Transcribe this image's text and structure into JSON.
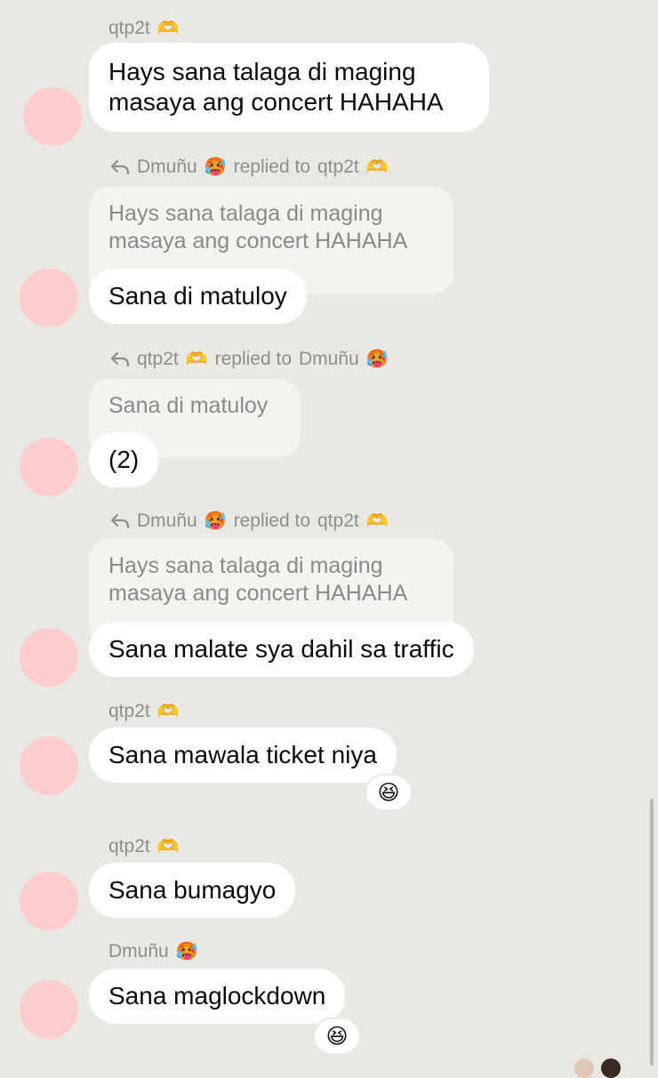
{
  "messages": [
    {
      "sender": "qtp2t",
      "sender_emoji": "🫶",
      "text": "Hays sana talaga di maging masaya ang concert HAHAHA"
    },
    {
      "sender": "Dmuñu",
      "sender_emoji": "🥵",
      "reply_label": "replied to",
      "reply_to": "qtp2t",
      "reply_to_emoji": "🫶",
      "quote": "Hays sana talaga di maging masaya ang concert HAHAHA",
      "text": "Sana di matuloy"
    },
    {
      "sender": "qtp2t",
      "sender_emoji": "🫶",
      "reply_label": "replied to",
      "reply_to": "Dmuñu",
      "reply_to_emoji": "🥵",
      "quote": "Sana di matuloy",
      "text": "(2)"
    },
    {
      "sender": "Dmuñu",
      "sender_emoji": "🥵",
      "reply_label": "replied to",
      "reply_to": "qtp2t",
      "reply_to_emoji": "🫶",
      "quote": "Hays sana talaga di maging masaya ang concert HAHAHA",
      "text": "Sana malate sya dahil sa traffic"
    },
    {
      "sender": "qtp2t",
      "sender_emoji": "🫶",
      "text": "Sana mawala ticket niya",
      "reaction": "😆"
    },
    {
      "sender": "qtp2t",
      "sender_emoji": "🫶",
      "text": "Sana bumagyo"
    },
    {
      "sender": "Dmuñu",
      "sender_emoji": "🥵",
      "text": "Sana maglockdown",
      "reaction": "😆"
    }
  ],
  "colors": {
    "background": "#e9e8e3",
    "bubble": "#ffffff",
    "quote": "#f4f3ef",
    "avatar": "#fbcdcd"
  }
}
